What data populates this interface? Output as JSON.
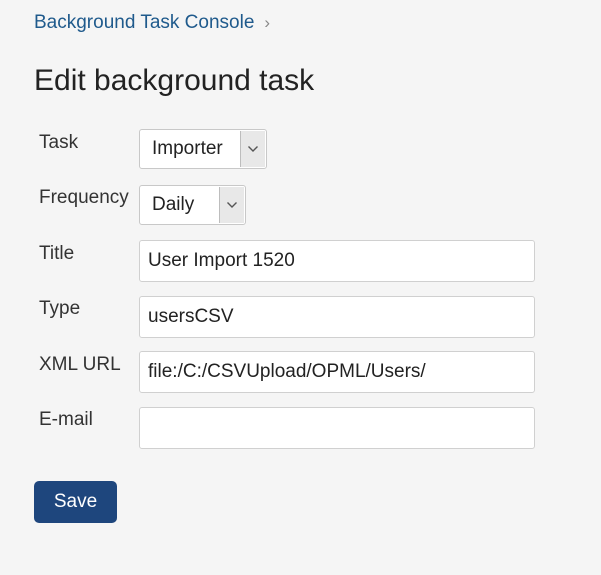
{
  "breadcrumb": {
    "link": "Background Task Console",
    "separator": "›"
  },
  "page_title": "Edit background task",
  "form": {
    "task": {
      "label": "Task",
      "selected": "Importer"
    },
    "frequency": {
      "label": "Frequency",
      "selected": "Daily"
    },
    "title": {
      "label": "Title",
      "value": "User Import 1520"
    },
    "type": {
      "label": "Type",
      "value": "usersCSV"
    },
    "xml_url": {
      "label": "XML URL",
      "value": "file:/C:/CSVUpload/OPML/Users/"
    },
    "email": {
      "label": "E-mail",
      "value": ""
    }
  },
  "save_button": {
    "label": "Save"
  },
  "icons": {
    "dropdown": "chevron-down-icon"
  },
  "colors": {
    "background": "#f5f5f5",
    "link": "#1f5a8c",
    "primary_button": "#1e467d"
  }
}
